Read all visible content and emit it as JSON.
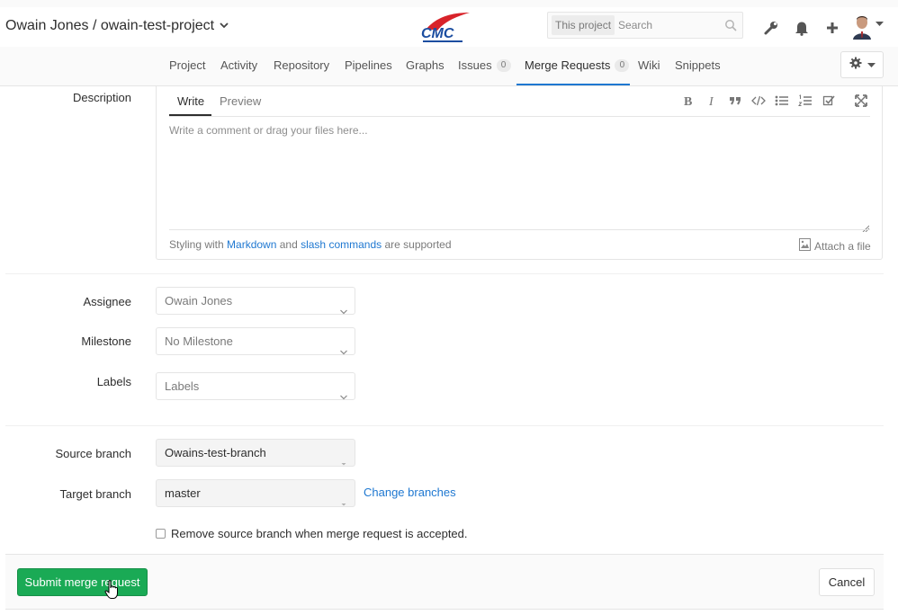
{
  "header": {
    "project_title": "Owain Jones / owain-test-project",
    "logo_text": "CMC",
    "search_scope": "This project",
    "search_placeholder": "Search"
  },
  "nav": {
    "items": [
      {
        "label": "Project"
      },
      {
        "label": "Activity"
      },
      {
        "label": "Repository"
      },
      {
        "label": "Pipelines"
      },
      {
        "label": "Graphs"
      },
      {
        "label": "Issues",
        "badge": "0"
      },
      {
        "label": "Merge Requests",
        "badge": "0",
        "active": true
      },
      {
        "label": "Wiki"
      },
      {
        "label": "Snippets"
      }
    ]
  },
  "form": {
    "description_label": "Description",
    "tabs": {
      "write": "Write",
      "preview": "Preview"
    },
    "textarea_placeholder": "Write a comment or drag your files here...",
    "hint": {
      "prefix": "Styling with ",
      "markdown": "Markdown",
      "middle": " and ",
      "slash": "slash commands",
      "suffix": " are supported"
    },
    "attach_label": "Attach a file",
    "assignee": {
      "label": "Assignee",
      "value": "Owain Jones"
    },
    "milestone": {
      "label": "Milestone",
      "value": "No Milestone"
    },
    "labels": {
      "label": "Labels",
      "value": "Labels"
    },
    "source_branch": {
      "label": "Source branch",
      "value": "Owains-test-branch"
    },
    "target_branch": {
      "label": "Target branch",
      "value": "master"
    },
    "change_branches": "Change branches",
    "remove_source_checkbox": "Remove source branch when merge request is accepted.",
    "submit_label": "Submit merge request",
    "cancel_label": "Cancel"
  },
  "colors": {
    "accent_blue": "#1f78d1",
    "submit_green": "#1aaa55",
    "logo_red": "#d8232a",
    "logo_blue": "#1c4ea0"
  }
}
